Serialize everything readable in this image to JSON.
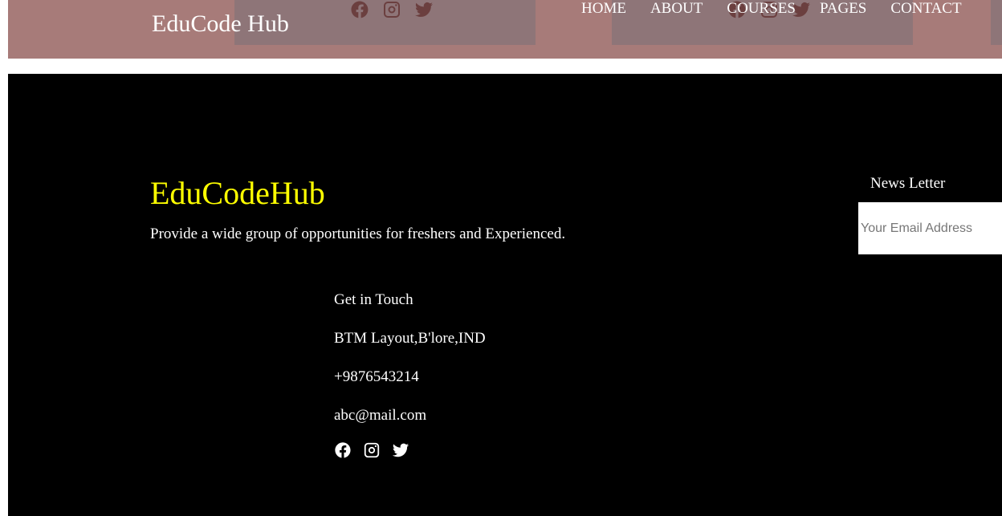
{
  "header": {
    "brand": "EduCode Hub",
    "nav": [
      "HOME",
      "ABOUT",
      "COURSES",
      "PAGES",
      "CONTACT"
    ],
    "social_icons": [
      "facebook-icon",
      "instagram-icon",
      "twitter-icon"
    ]
  },
  "footer": {
    "title": "EduCodeHub",
    "description": "Provide a wide group of opportunities for freshers and Experienced.",
    "contact": {
      "heading": "Get in Touch",
      "address": "BTM Layout,B'lore,IND",
      "phone": "+9876543214",
      "email": "abc@mail.com",
      "social_icons": [
        "facebook-icon",
        "instagram-icon",
        "twitter-icon"
      ]
    },
    "newsletter": {
      "label": "News Letter",
      "placeholder": "Your Email Address",
      "value": ""
    }
  },
  "colors": {
    "header_bg": "#a77b79",
    "header_panel": "#8e7578",
    "header_icon": "#6b3f3f",
    "footer_bg": "#000000",
    "footer_title": "#ffff00",
    "text": "#ffffff"
  }
}
